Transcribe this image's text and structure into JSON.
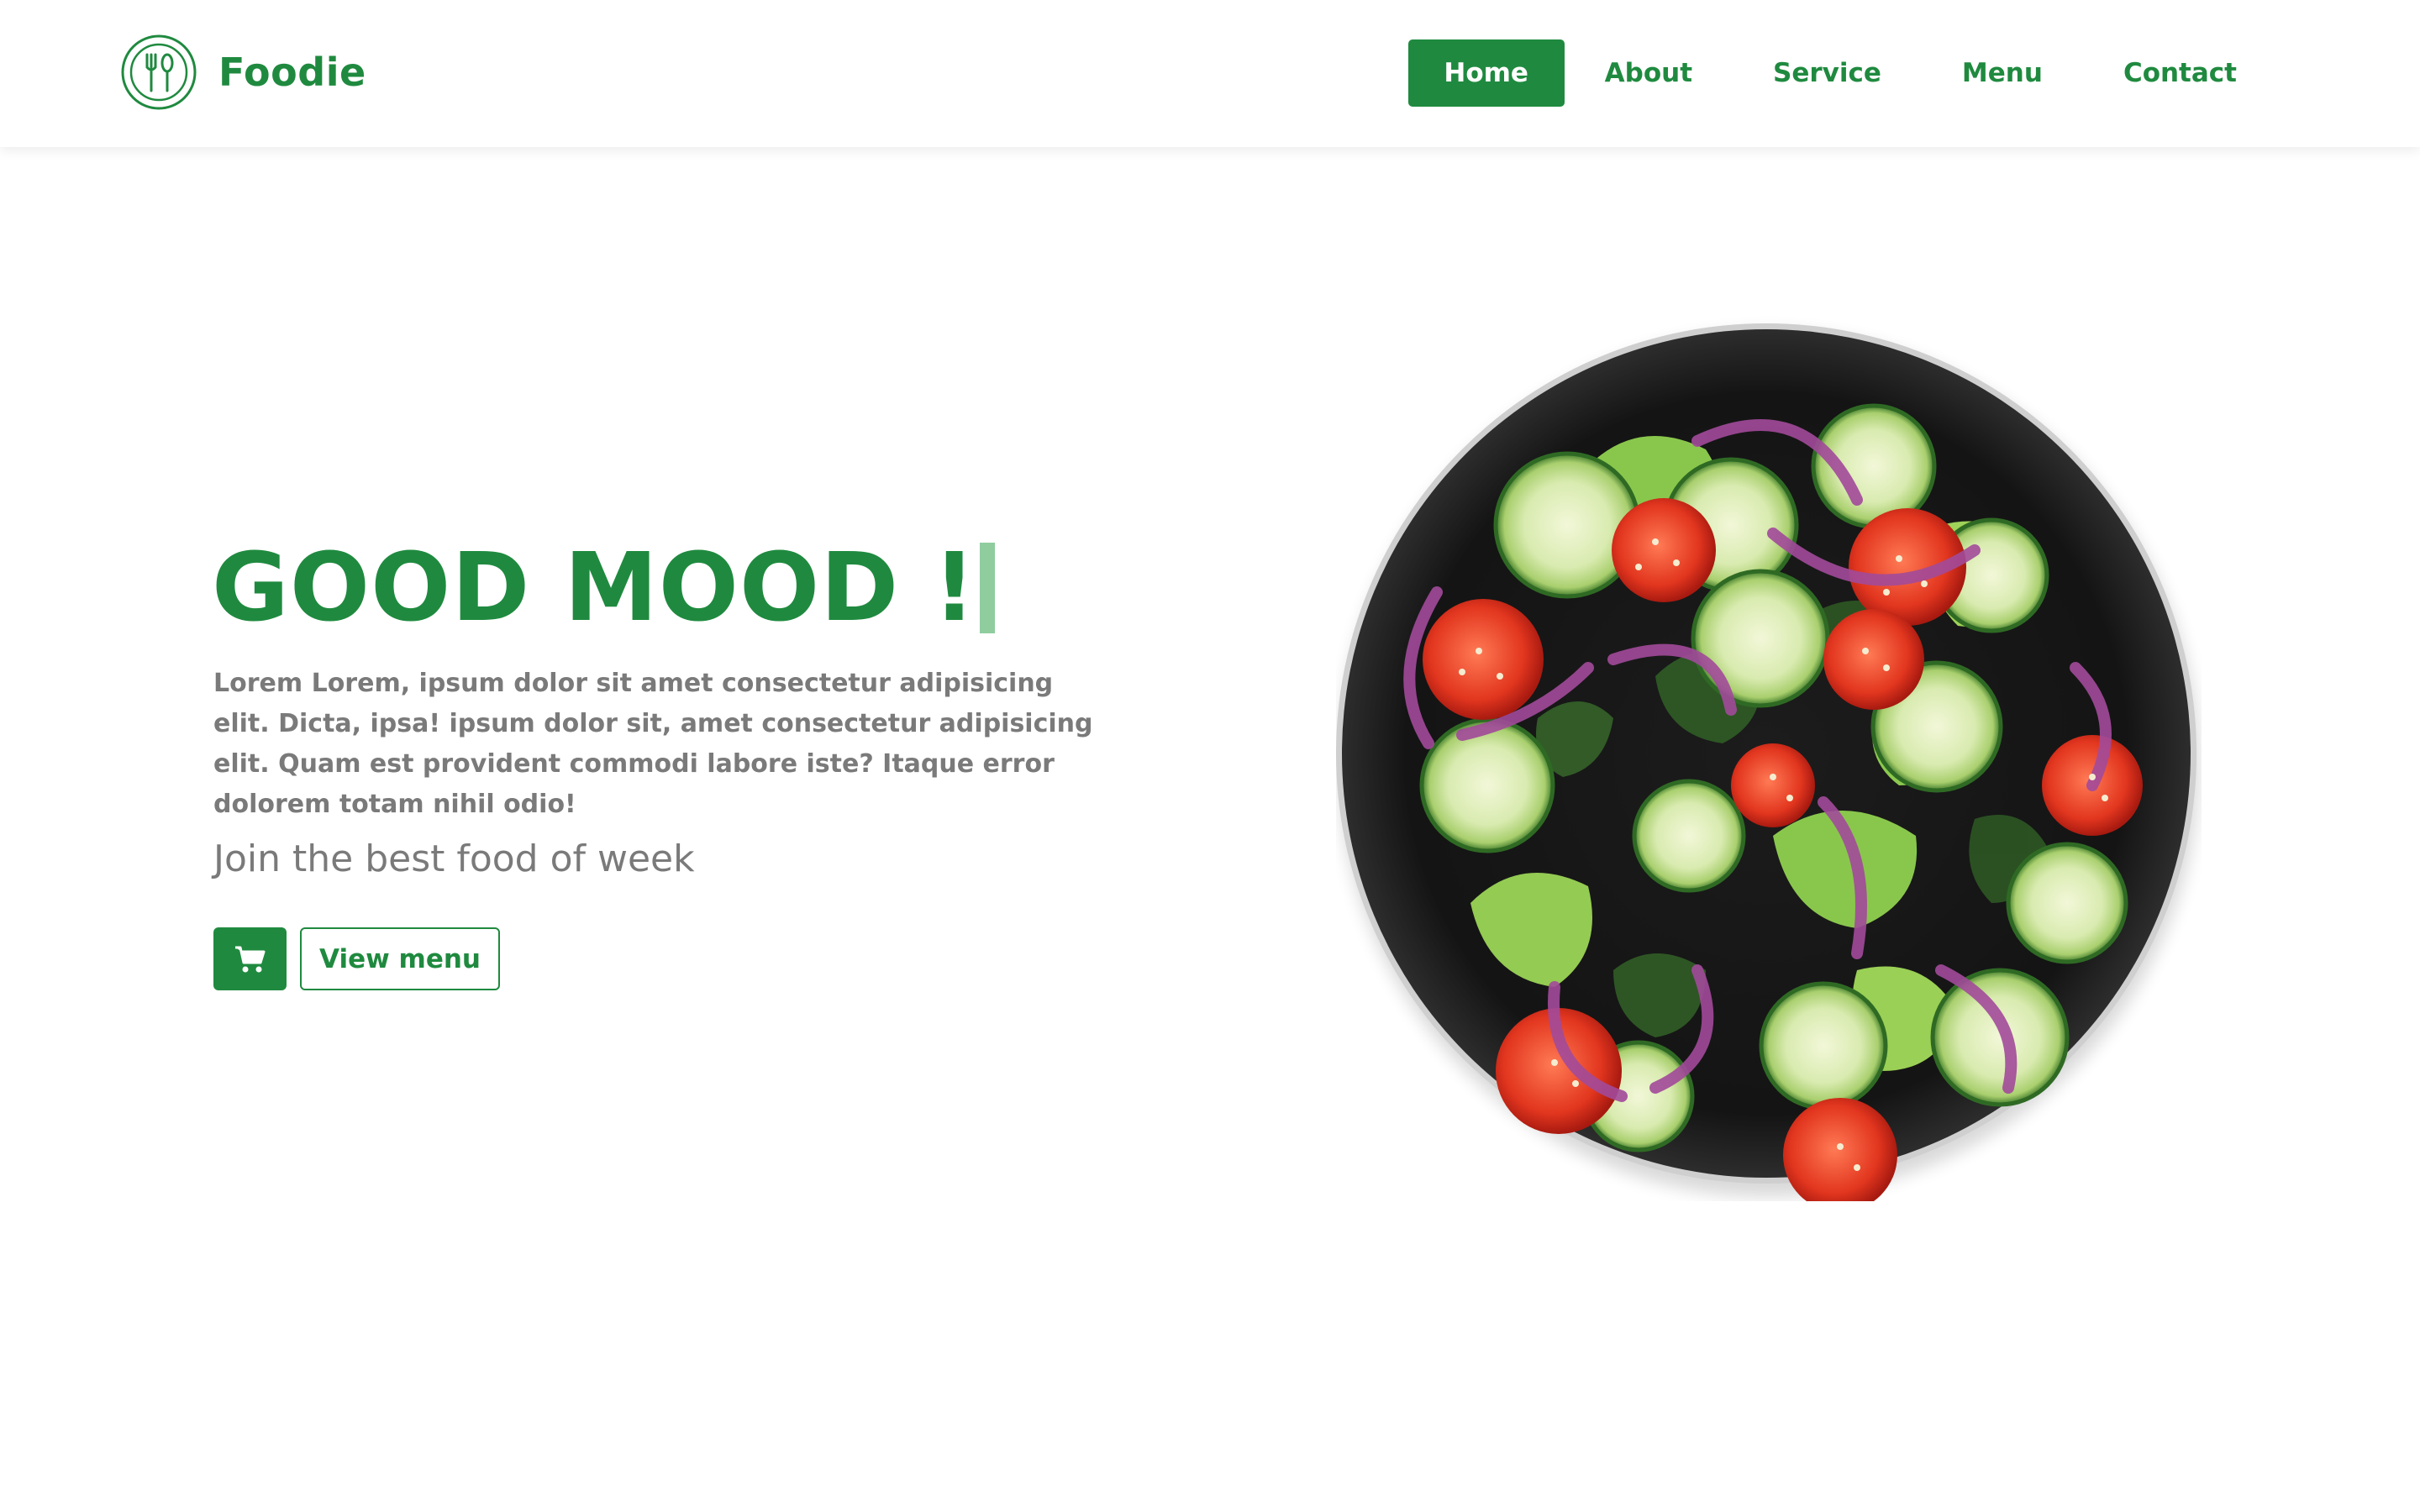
{
  "brand": {
    "name": "Foodie",
    "logo_icon": "fork-spoon-icon"
  },
  "nav": {
    "items": [
      {
        "label": "Home",
        "active": true
      },
      {
        "label": "About",
        "active": false
      },
      {
        "label": "Service",
        "active": false
      },
      {
        "label": "Menu",
        "active": false
      },
      {
        "label": "Contact",
        "active": false
      }
    ]
  },
  "hero": {
    "title": "GOOD MOOD !",
    "description": "Lorem Lorem, ipsum dolor sit amet consectetur adipisicing elit. Dicta, ipsa! ipsum dolor sit, amet consectetur adipisicing elit. Quam est provident commodi labore iste? Itaque error dolorem totam nihil odio!",
    "subtitle": "Join the best food of week",
    "cart_icon": "shopping-cart-icon",
    "view_menu_label": "View menu"
  },
  "image": {
    "subject": "salad-bowl"
  },
  "colors": {
    "brand_green": "#1f8a3f",
    "caret_green": "#8fcd9f",
    "text_gray": "#7a7a7a",
    "background": "#ffffff"
  }
}
